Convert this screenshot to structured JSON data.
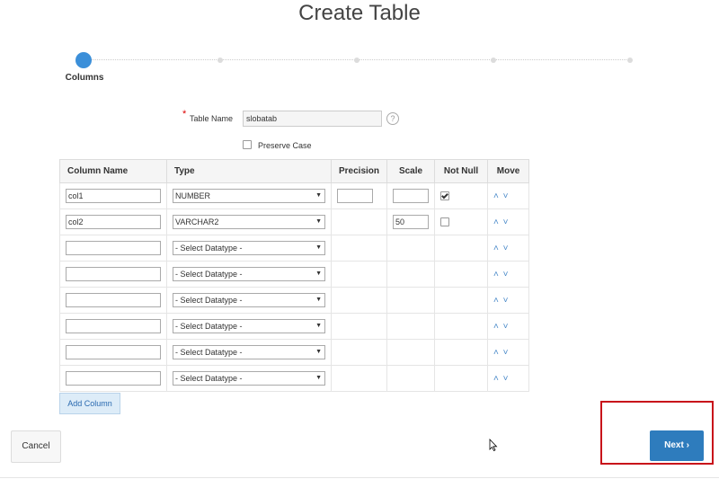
{
  "page": {
    "title": "Create Table"
  },
  "wizard": {
    "current_step_label": "Columns",
    "step_count": 5
  },
  "form": {
    "table_name_label": "Table Name",
    "table_name_value": "slobatab",
    "required_marker": "*",
    "help_icon": "?",
    "preserve_case_label": "Preserve Case",
    "preserve_case_checked": false
  },
  "grid": {
    "headers": [
      "Column Name",
      "Type",
      "Precision",
      "Scale",
      "Not Null",
      "Move"
    ],
    "rows": [
      {
        "name": "col1",
        "type": "NUMBER",
        "precision": "",
        "scale": "",
        "not_null": true,
        "show_precision": true,
        "show_scale": true
      },
      {
        "name": "col2",
        "type": "VARCHAR2",
        "precision": "",
        "scale": "50",
        "not_null": false,
        "show_precision": false,
        "show_scale": true
      },
      {
        "name": "",
        "type": "- Select Datatype -"
      },
      {
        "name": "",
        "type": "- Select Datatype -"
      },
      {
        "name": "",
        "type": "- Select Datatype -"
      },
      {
        "name": "",
        "type": "- Select Datatype -"
      },
      {
        "name": "",
        "type": "- Select Datatype -"
      },
      {
        "name": "",
        "type": "- Select Datatype -"
      }
    ],
    "move_up_icon": "chevron-up-icon",
    "move_down_icon": "chevron-down-icon"
  },
  "actions": {
    "add_column_label": "Add Column",
    "cancel_label": "Cancel",
    "next_label": "Next"
  },
  "colors": {
    "accent": "#2e7cbd",
    "highlight": "#c8101a"
  }
}
